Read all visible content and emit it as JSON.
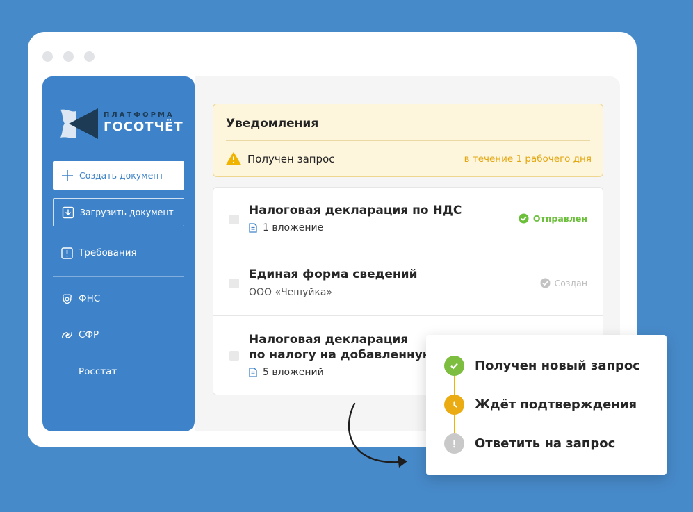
{
  "logo": {
    "line1": "ПЛАТФОРМА",
    "line2": "ГОСОТЧЁТ"
  },
  "sidebar": {
    "create_label": "Создать документ",
    "upload_label": "Загрузить документ",
    "requirements_label": "Требования",
    "items": [
      {
        "label": "ФНС",
        "icon": "fns-emblem-icon"
      },
      {
        "label": "СФР",
        "icon": "sfr-link-icon"
      },
      {
        "label": "Росстат",
        "icon": ""
      }
    ]
  },
  "notifications": {
    "title": "Уведомления",
    "item_text": "Получен запрос",
    "deadline": "в течение 1 рабочего дня"
  },
  "documents": [
    {
      "title": "Налоговая декларация по НДС",
      "subtitle": "1 вложение",
      "status": "Отправлен",
      "status_color": "#6CBF3B"
    },
    {
      "title": "Единая форма сведений",
      "subtitle": "ООО «Чешуйка»",
      "status": "Создан",
      "status_color": "#C0C0C0"
    },
    {
      "title_line1": "Налоговая декларация",
      "title_line2": "по налогу на добавленную",
      "subtitle": "5 вложений"
    }
  ],
  "popup": {
    "steps": [
      {
        "label": "Получен новый запрос",
        "color": "#7DBD3F"
      },
      {
        "label": "Ждёт подтверждения",
        "color": "#EAAC12"
      },
      {
        "label": "Ответить на запрос",
        "color": "#C9C9C9"
      }
    ]
  },
  "colors": {
    "background": "#478ACA",
    "sidebar": "#3E83C9",
    "accent_yellow": "#E3A711"
  }
}
